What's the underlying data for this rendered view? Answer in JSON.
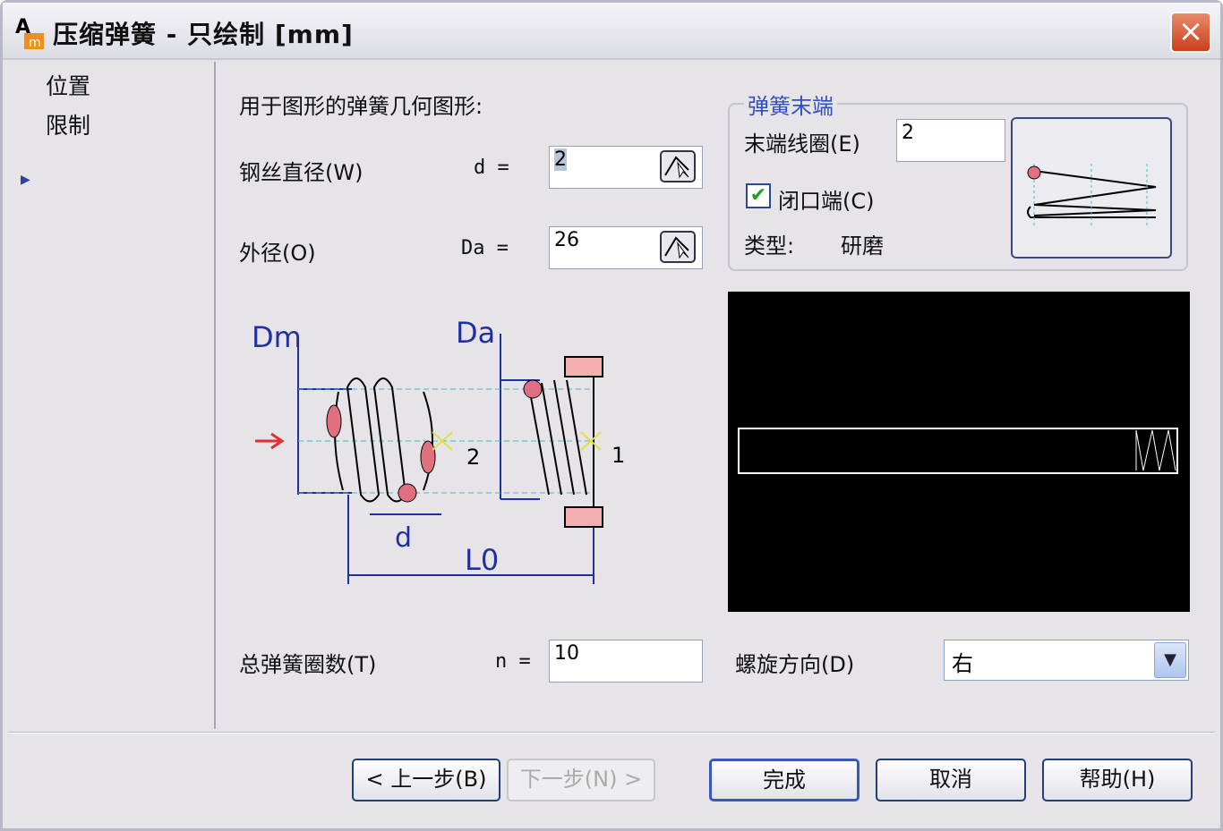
{
  "window": {
    "title": "压缩弹簧 - 只绘制 [mm]",
    "close_icon": "×"
  },
  "nav": {
    "items": [
      {
        "label": "位置"
      },
      {
        "label": "限制",
        "active": true
      }
    ]
  },
  "main": {
    "heading": "用于图形的弹簧几何图形:",
    "wire_diameter": {
      "label": "钢丝直径(W)",
      "symbol": "d =",
      "value": "2"
    },
    "outer_diameter": {
      "label": "外径(O)",
      "symbol": "Da =",
      "value": "26"
    },
    "total_coils": {
      "label": "总弹簧圈数(T)",
      "symbol": "n =",
      "value": "10"
    },
    "diagram": {
      "dm": "Dm",
      "da": "Da",
      "d": "d",
      "l0": "L0",
      "n2": "2",
      "n1": "1"
    }
  },
  "spring_ends": {
    "title": "弹簧末端",
    "end_coils_label": "末端线圈(E)",
    "end_coils_value": "2",
    "closed_label": "闭口端(C)",
    "closed_checked": true,
    "type_label": "类型:",
    "type_value": "研磨"
  },
  "helix": {
    "label": "螺旋方向(D)",
    "value": "右"
  },
  "buttons": {
    "back": "< 上一步(B)",
    "next": "下一步(N) >",
    "finish": "完成",
    "cancel": "取消",
    "help": "帮助(H)"
  }
}
